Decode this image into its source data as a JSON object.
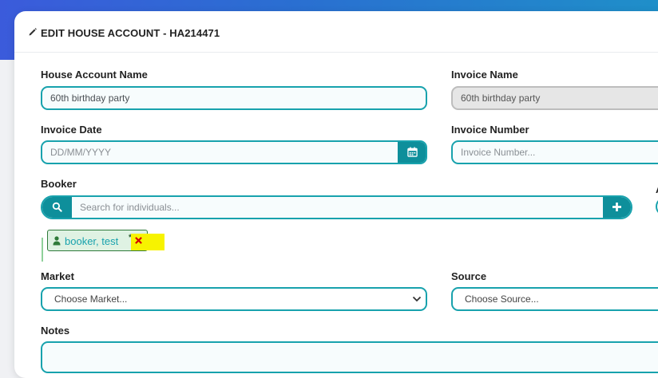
{
  "modal": {
    "title": "EDIT HOUSE ACCOUNT - HA214471"
  },
  "fields": {
    "house_account_name": {
      "label": "House Account Name",
      "value": "60th birthday party"
    },
    "invoice_name": {
      "label": "Invoice Name",
      "value": "60th birthday party"
    },
    "invoice_date": {
      "label": "Invoice Date",
      "placeholder": "DD/MM/YYYY"
    },
    "invoice_number": {
      "label": "Invoice Number",
      "placeholder": "Invoice Number..."
    },
    "booker": {
      "label": "Booker",
      "placeholder": "Search for individuals...",
      "chip_label": "booker, test",
      "chip_star": "*"
    },
    "market": {
      "label": "Market",
      "selected": "Choose Market..."
    },
    "source": {
      "label": "Source",
      "selected": "Choose Source..."
    },
    "notes": {
      "label": "Notes"
    }
  },
  "edge": {
    "partial_label": "A"
  },
  "colors": {
    "accent": "#18a2ad",
    "button": "#0e8f9b",
    "chip_border": "#2f7a3a",
    "highlight": "#f7f300",
    "remove": "#d40000"
  },
  "icons": {
    "title": "pencil-icon",
    "invoice_date": "calendar-icon",
    "booker_search": "search-icon",
    "booker_add": "plus-icon",
    "chip": "user-icon",
    "chip_remove": "close-icon",
    "dropdown": "chevron-down-icon"
  }
}
